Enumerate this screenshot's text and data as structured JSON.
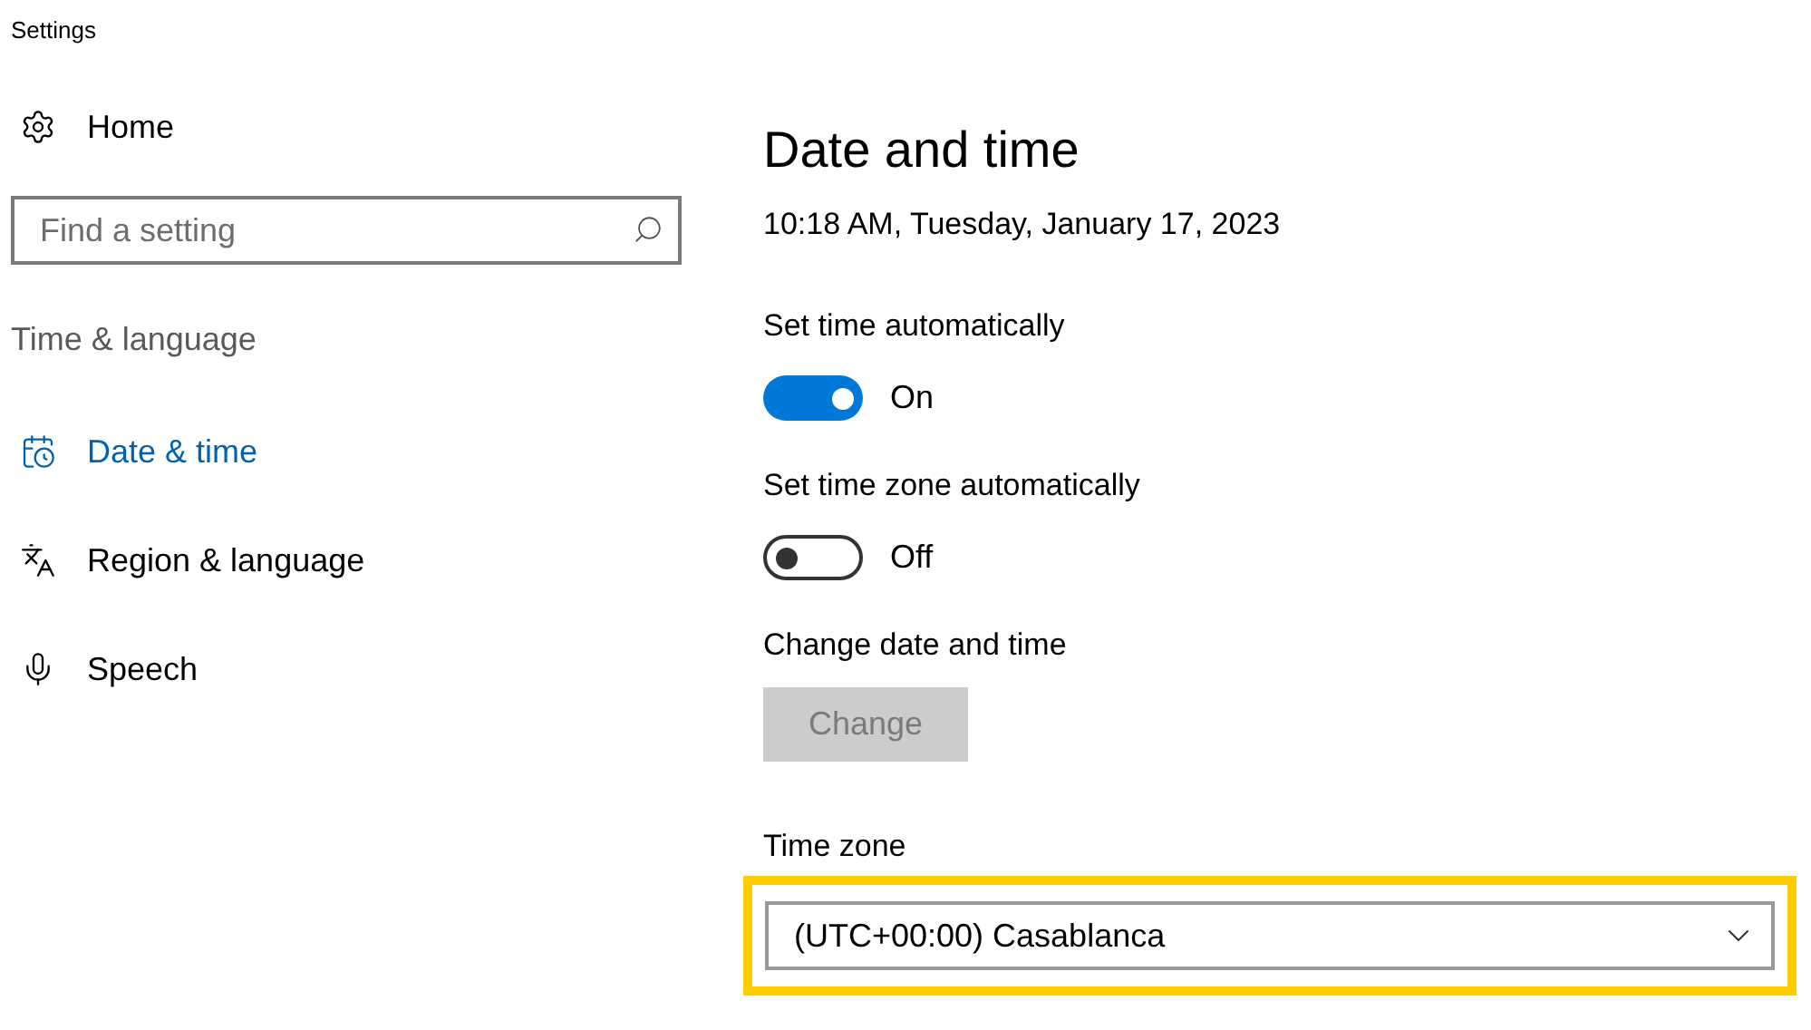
{
  "window": {
    "title": "Settings"
  },
  "sidebar": {
    "home": {
      "label": "Home",
      "kind": "gear"
    },
    "search": {
      "placeholder": "Find a setting"
    },
    "section": "Time & language",
    "items": [
      {
        "label": "Date & time",
        "kind": "calendar",
        "selected": true
      },
      {
        "label": "Region & language",
        "kind": "language",
        "selected": false
      },
      {
        "label": "Speech",
        "kind": "mic",
        "selected": false
      }
    ]
  },
  "main": {
    "title": "Date and time",
    "current": "10:18 AM, Tuesday, January 17, 2023",
    "settings": [
      {
        "kind": "toggle",
        "label": "Set time automatically",
        "on": true,
        "state_label": "On"
      },
      {
        "kind": "toggle",
        "label": "Set time zone automatically",
        "on": false,
        "state_label": "Off"
      },
      {
        "kind": "button",
        "label": "Change date and time",
        "button": "Change",
        "disabled": true
      },
      {
        "kind": "dropdown",
        "label": "Time zone",
        "value": "(UTC+00:00) Casablanca",
        "highlighted": true
      }
    ]
  }
}
